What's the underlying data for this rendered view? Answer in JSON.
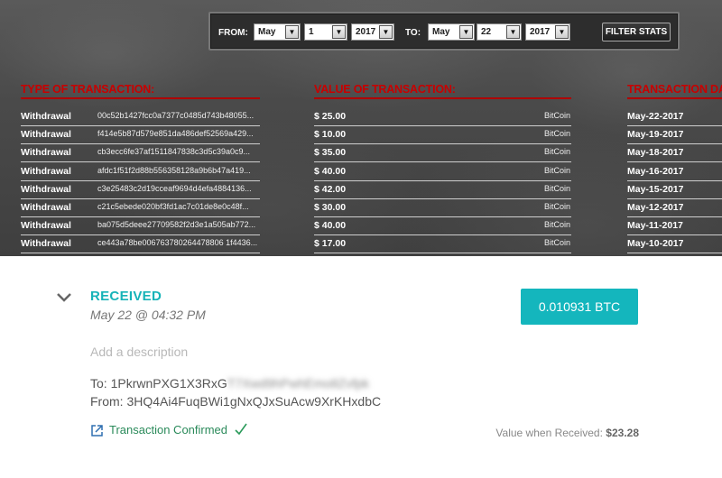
{
  "filter": {
    "from_label": "FROM:",
    "to_label": "TO:",
    "from_month": "May",
    "from_day": "1",
    "from_year": "2017",
    "to_month": "May",
    "to_day": "22",
    "to_year": "2017",
    "button_label": "FILTER STATS"
  },
  "table": {
    "headers": {
      "type": "TYPE OF TRANSACTION:",
      "value": "VALUE OF TRANSACTION:",
      "date": "TRANSACTION DA"
    },
    "rows": [
      {
        "type": "Withdrawal",
        "hash": "00c52b1427fcc0a7377c0485d743b48055...",
        "value": "$ 25.00",
        "currency": "BitCoin",
        "date": "May-22-2017"
      },
      {
        "type": "Withdrawal",
        "hash": "f414e5b87d579e851da486def52569a429...",
        "value": "$ 10.00",
        "currency": "BitCoin",
        "date": "May-19-2017"
      },
      {
        "type": "Withdrawal",
        "hash": "cb3ecc6fe37af1511847838c3d5c39a0c9...",
        "value": "$ 35.00",
        "currency": "BitCoin",
        "date": "May-18-2017"
      },
      {
        "type": "Withdrawal",
        "hash": "afdc1f51f2d88b556358128a9b6b47a419...",
        "value": "$ 40.00",
        "currency": "BitCoin",
        "date": "May-16-2017"
      },
      {
        "type": "Withdrawal",
        "hash": "c3e25483c2d19cceaf9694d4efa4884136...",
        "value": "$ 42.00",
        "currency": "BitCoin",
        "date": "May-15-2017"
      },
      {
        "type": "Withdrawal",
        "hash": "c21c5ebede020bf3fd1ac7c01de8e0c48f...",
        "value": "$ 30.00",
        "currency": "BitCoin",
        "date": "May-12-2017"
      },
      {
        "type": "Withdrawal",
        "hash": "ba075d5deee27709582f2d3e1a505ab772...",
        "value": "$ 40.00",
        "currency": "BitCoin",
        "date": "May-11-2017"
      },
      {
        "type": "Withdrawal",
        "hash": "ce443a78be006763780264478806 1f4436...",
        "value": "$ 17.00",
        "currency": "BitCoin",
        "date": "May-10-2017"
      }
    ]
  },
  "transaction": {
    "status": "RECEIVED",
    "date": "May 22 @ 04:32 PM",
    "amount": "0.010931 BTC",
    "description_placeholder": "Add a description",
    "to_prefix": "To: 1PkrwnPXG1X3RxG",
    "to_hidden": "T7Xwd9hPwhEmo8Zvfpk",
    "from_address": "From: 3HQ4Ai4FuqBWi1gNxQJxSuAcw9XrKHxdbC",
    "confirmed_label": "Transaction Confirmed",
    "value_when_label": "Value when Received:",
    "value_when_amount": "$23.28"
  },
  "colors": {
    "accent": "#14b6bd",
    "header_red": "#c80000",
    "confirmed_green": "#2a8a5a"
  },
  "icons": [
    "chevron-down-icon",
    "external-link-icon",
    "checkmark-icon",
    "dropdown-arrow-icon"
  ]
}
